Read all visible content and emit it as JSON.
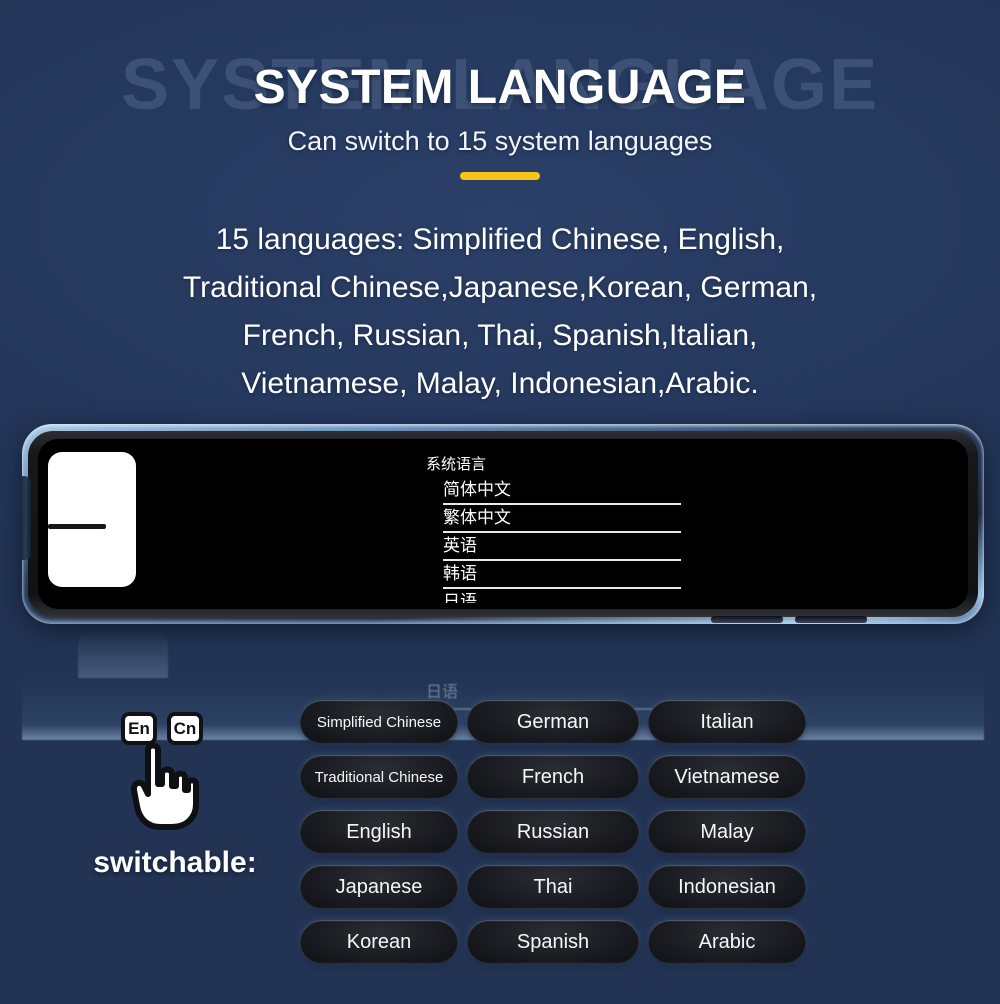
{
  "header": {
    "title": "SYSTEM LANGUAGE",
    "ghost_title": "SYSTEM LANGUAGE",
    "subtitle": "Can switch to 15 system languages",
    "divider_color": "#f5c518"
  },
  "intro": {
    "lines": [
      "15 languages: Simplified Chinese,  English,",
      "Traditional Chinese,Japanese,Korean, German,",
      "French, Russian, Thai, Spanish,Italian,",
      "Vietnamese, Malay, Indonesian,Arabic."
    ]
  },
  "device": {
    "menu": {
      "title": "系统语言",
      "items": [
        "简体中文",
        "繁体中文",
        "英语",
        "韩语",
        "日语"
      ]
    },
    "reflection_text": "日语"
  },
  "switchable": {
    "label": "switchable:",
    "key_en": "En",
    "key_cn": "Cn"
  },
  "languages": {
    "column1": [
      {
        "label": "Simplified Chinese",
        "size": "small"
      },
      {
        "label": "Traditional Chinese",
        "size": "small"
      },
      {
        "label": "English",
        "size": "normal"
      },
      {
        "label": "Japanese",
        "size": "normal"
      },
      {
        "label": "Korean",
        "size": "normal"
      }
    ],
    "column2": [
      {
        "label": "German",
        "size": "normal"
      },
      {
        "label": "French",
        "size": "normal"
      },
      {
        "label": "Russian",
        "size": "normal"
      },
      {
        "label": "Thai",
        "size": "normal"
      },
      {
        "label": "Spanish",
        "size": "normal"
      }
    ],
    "column3": [
      {
        "label": "Italian",
        "size": "normal"
      },
      {
        "label": "Vietnamese",
        "size": "normal"
      },
      {
        "label": "Malay",
        "size": "normal"
      },
      {
        "label": "Indonesian",
        "size": "normal"
      },
      {
        "label": "Arabic",
        "size": "normal"
      }
    ],
    "order": [
      "Simplified Chinese",
      "German",
      "Italian",
      "Traditional Chinese",
      "French",
      "Vietnamese",
      "English",
      "Russian",
      "Malay",
      "Japanese",
      "Thai",
      "Indonesian",
      "Korean",
      "Spanish",
      "Arabic"
    ]
  },
  "colors": {
    "background": "#24385e",
    "accent": "#f5c518",
    "text": "#ffffff",
    "ghost": "#3d5176",
    "pill": "#1a1c21"
  }
}
